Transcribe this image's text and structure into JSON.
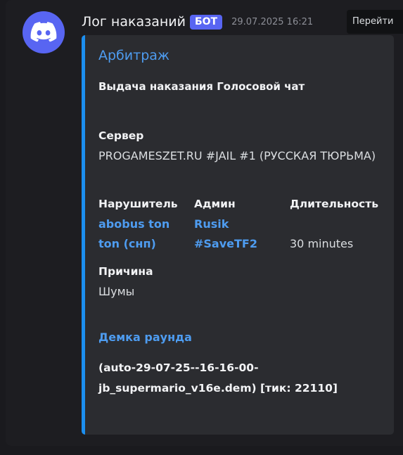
{
  "message": {
    "author": "Лог наказаний",
    "badge": "БОТ",
    "timestamp": "29.07.2025 16:21",
    "goto_label": "Перейти"
  },
  "embed": {
    "title": "Арбитраж",
    "description": "Выдача наказания Голосовой чат",
    "server": {
      "name": "Сервер",
      "value": "PROGAMESZET.RU #JAIL #1 (РУССКАЯ ТЮРЬМА)"
    },
    "offender": {
      "name": "Нарушитель",
      "value": "abobus ton ton (снп)"
    },
    "admin": {
      "name": "Админ",
      "value": "Rusik #SaveTF2"
    },
    "duration": {
      "name": "Длительность",
      "value": "30 minutes"
    },
    "reason": {
      "name": "Причина",
      "value": "Шумы"
    },
    "demo": {
      "title": "Демка раунда",
      "text": "(auto-29-07-25--16-16-00-jb_supermario_v16e.dem) [тик: 22110]"
    }
  },
  "colors": {
    "accent": "#1c8ff0",
    "link": "#4e9cf0",
    "badge": "#5865f2",
    "embed_bg": "#2b2c30"
  },
  "icons": {
    "avatar": "discord-logo-icon"
  }
}
